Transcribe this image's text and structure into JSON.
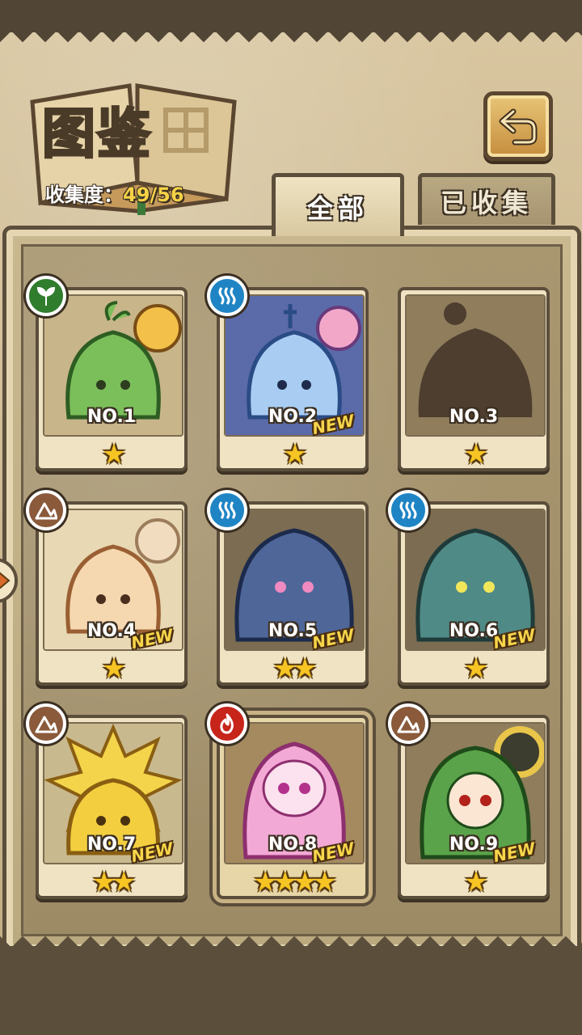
{
  "header": {
    "title": "图鉴",
    "progress_label": "收集度：",
    "progress_value": "49/56"
  },
  "tabs": [
    {
      "label": "全部",
      "active": true
    },
    {
      "label": "已收集",
      "active": false
    }
  ],
  "colors": {
    "grass": "#2f7d2d",
    "water": "#1f84c4",
    "earth": "#8a5a3b",
    "fire": "#c7241a",
    "star": "#f7c523"
  },
  "cards": [
    {
      "number": "NO.1",
      "stars": "★",
      "element": "grass",
      "is_new": false,
      "new_label": ""
    },
    {
      "number": "NO.2",
      "stars": "★",
      "element": "water",
      "is_new": true,
      "new_label": "NEW"
    },
    {
      "number": "NO.3",
      "stars": "★",
      "element": "",
      "is_new": false,
      "new_label": ""
    },
    {
      "number": "NO.4",
      "stars": "★",
      "element": "earth",
      "is_new": true,
      "new_label": "NEW"
    },
    {
      "number": "NO.5",
      "stars": "★★",
      "element": "water",
      "is_new": true,
      "new_label": "NEW"
    },
    {
      "number": "NO.6",
      "stars": "★",
      "element": "water",
      "is_new": true,
      "new_label": "NEW"
    },
    {
      "number": "NO.7",
      "stars": "★★",
      "element": "earth",
      "is_new": true,
      "new_label": "NEW"
    },
    {
      "number": "NO.8",
      "stars": "★★★★",
      "element": "fire",
      "is_new": true,
      "new_label": "NEW"
    },
    {
      "number": "NO.9",
      "stars": "★",
      "element": "earth",
      "is_new": true,
      "new_label": "NEW"
    }
  ]
}
